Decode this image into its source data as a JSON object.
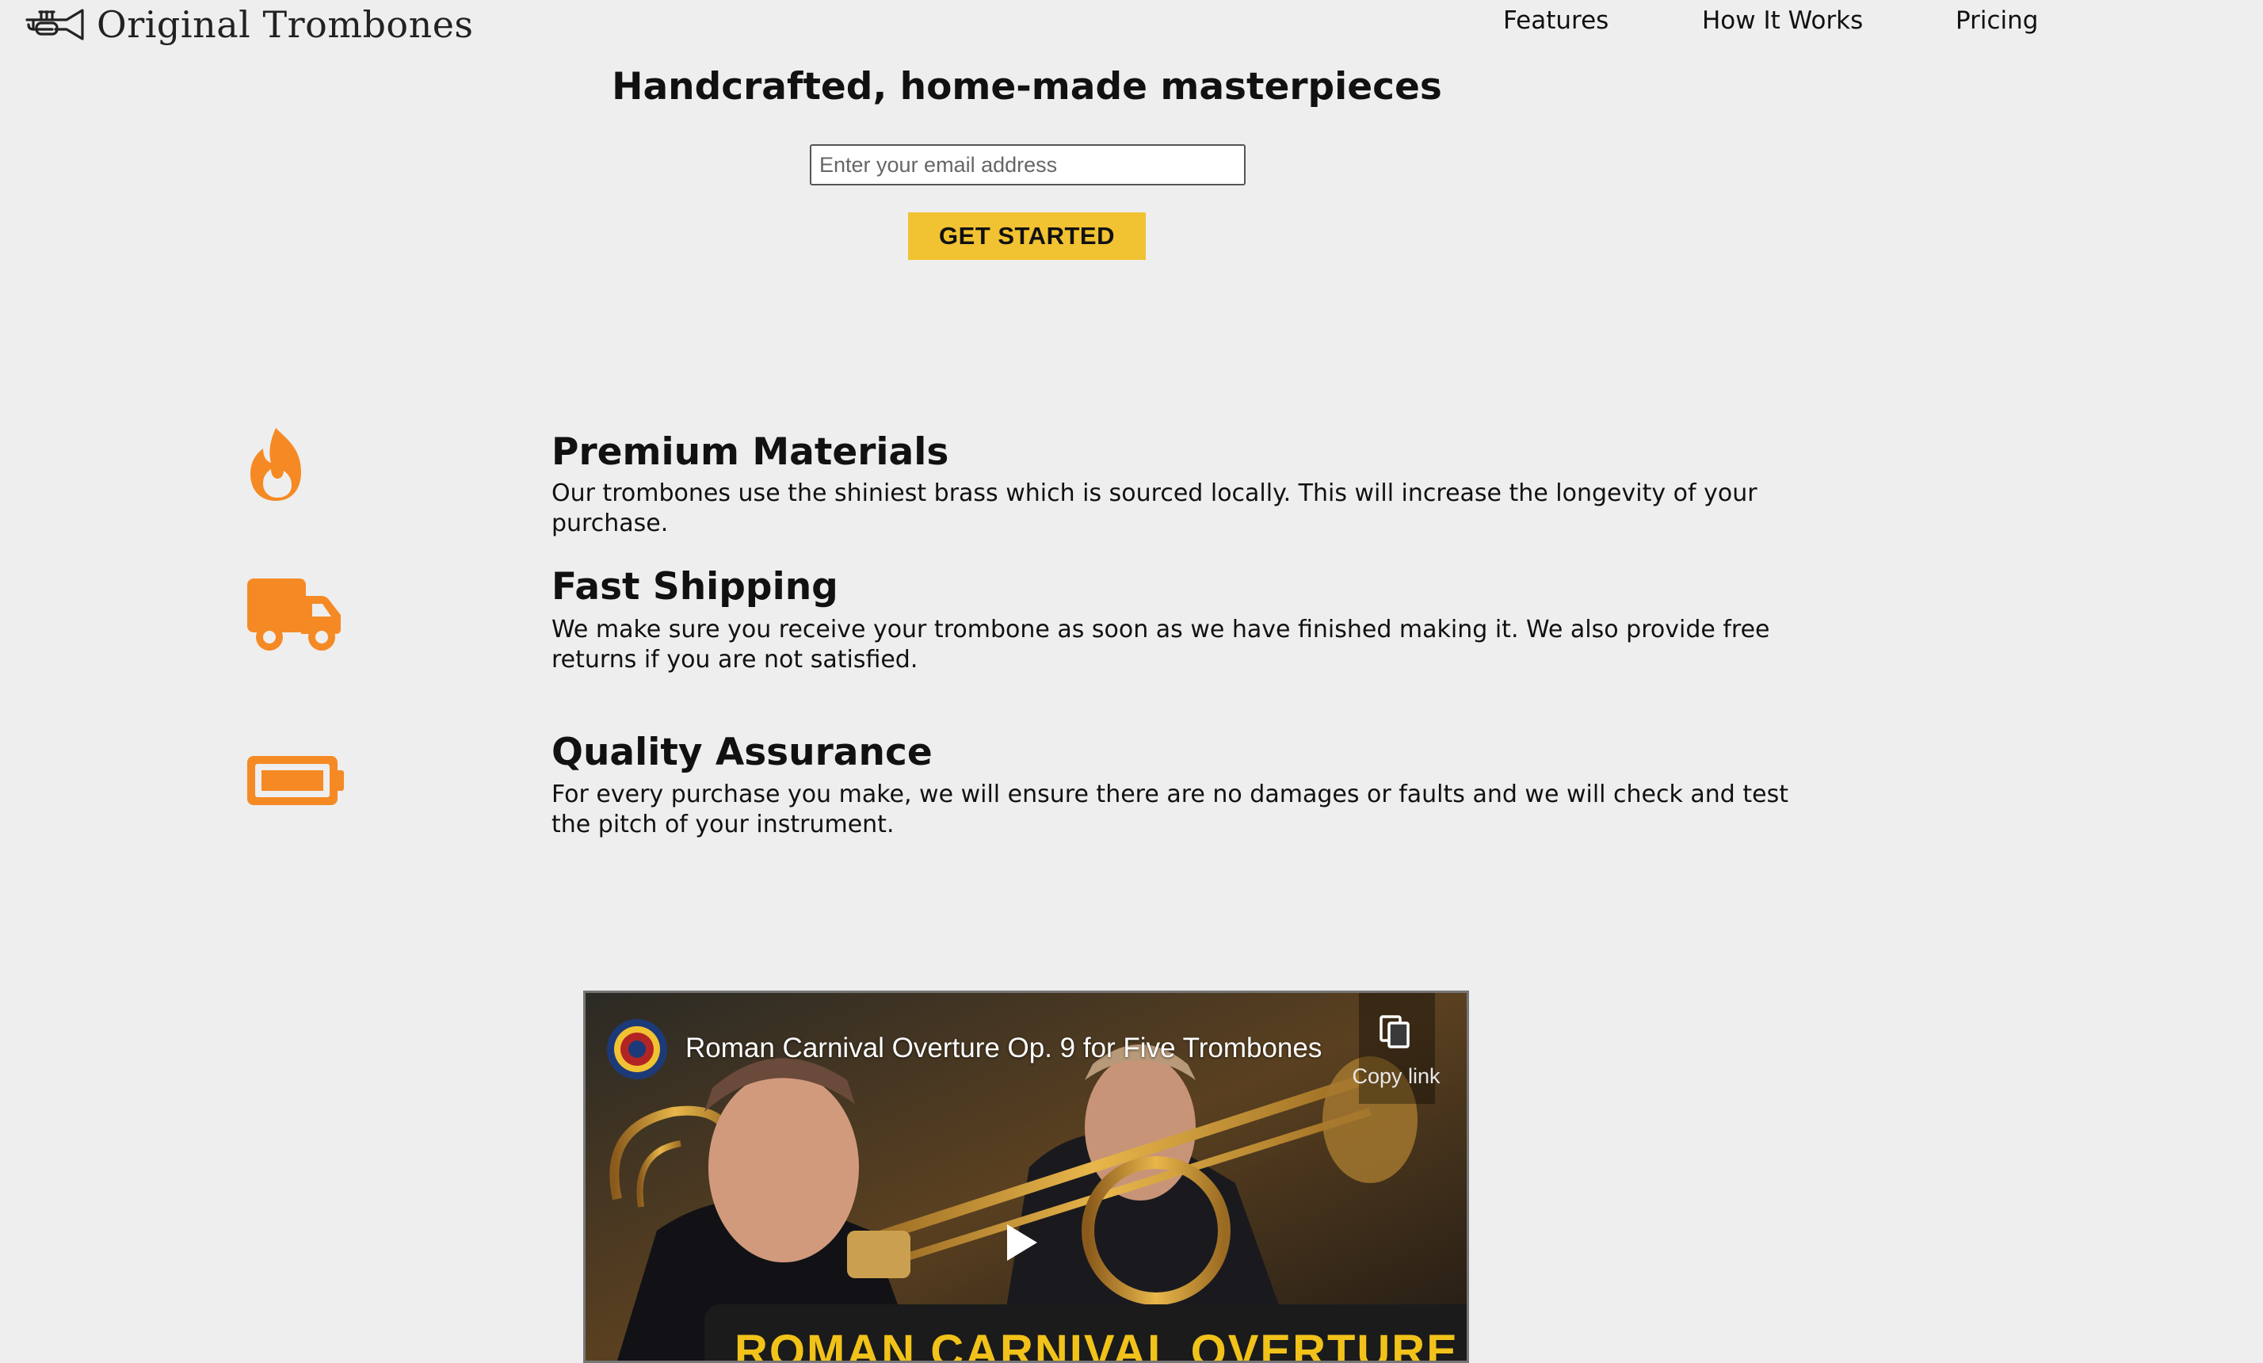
{
  "brand": {
    "name": "Original Trombones",
    "icon": "trumpet-icon"
  },
  "nav": {
    "features": "Features",
    "how_it_works": "How It Works",
    "pricing": "Pricing"
  },
  "hero": {
    "title": "Handcrafted, home-made masterpieces",
    "email_placeholder": "Enter your email address",
    "cta_label": "GET STARTED"
  },
  "features": [
    {
      "icon": "fire-icon",
      "title": "Premium Materials",
      "text": "Our trombones use the shiniest brass which is sourced locally. This will increase the longevity of your purchase."
    },
    {
      "icon": "truck-icon",
      "title": "Fast Shipping",
      "text": "We make sure you receive your trombone as soon as we have finished making it. We also provide free returns if you are not satisfied."
    },
    {
      "icon": "battery-full-icon",
      "title": "Quality Assurance",
      "text": "For every purchase you make, we will ensure there are no damages or faults and we will check and test the pitch of your instrument."
    }
  ],
  "video": {
    "title": "Roman Carnival Overture Op. 9 for Five Trombones",
    "copy_link_label": "Copy link",
    "banner_text": "ROMAN CARNIVAL OVERTURE"
  },
  "colors": {
    "background": "#eeeeee",
    "accent_orange": "#f58a25",
    "cta_yellow": "#f1c232",
    "banner_yellow": "#f1c21a"
  }
}
